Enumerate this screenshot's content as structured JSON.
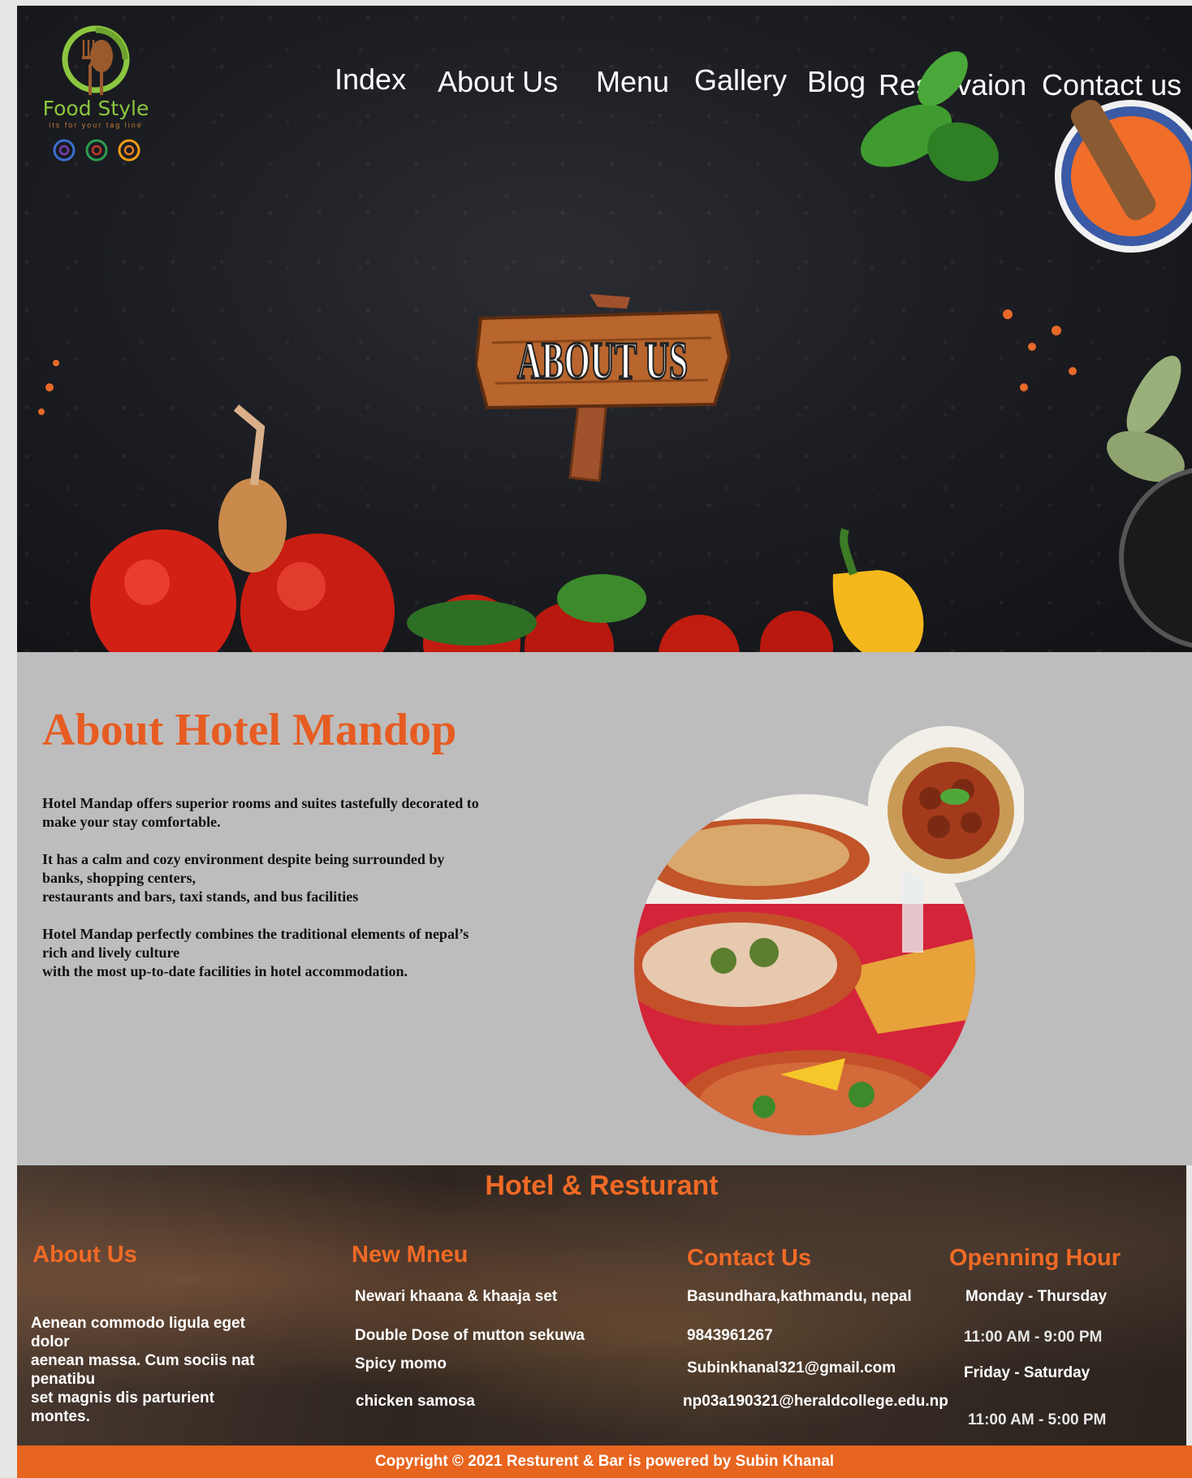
{
  "brand": {
    "name": "Food Style",
    "tagline": "its for your tag line"
  },
  "nav": {
    "items": [
      {
        "label": "Index"
      },
      {
        "label": "About Us"
      },
      {
        "label": "Menu"
      },
      {
        "label": "Gallery"
      },
      {
        "label": "Blog"
      },
      {
        "label": "Reservaion"
      },
      {
        "label": "Contact us"
      }
    ]
  },
  "hero": {
    "sign_text": "ABOUT US"
  },
  "about": {
    "title": "About Hotel Mandop",
    "paragraphs": [
      "Hotel Mandap offers superior rooms and suites tastefully decorated to\nmake your stay comfortable.",
      "It has a calm and cozy environment despite being surrounded by\nbanks, shopping centers,\nrestaurants and bars, taxi stands, and bus facilities",
      "Hotel Mandap perfectly combines the traditional elements of nepal’s\nrich and lively culture\nwith the most up-to-date facilities in hotel accommodation."
    ]
  },
  "footer": {
    "heading": "Hotel & Resturant",
    "about": {
      "title": "About Us",
      "text": "Aenean commodo ligula eget\ndolor\naenean massa. Cum sociis nat\npenatibu\nset magnis dis parturient\nmontes."
    },
    "menu": {
      "title": "New Mneu",
      "items": [
        "Newari khaana & khaaja set",
        "Double Dose of mutton sekuwa",
        "Spicy momo",
        "chicken samosa"
      ]
    },
    "contact": {
      "title": "Contact Us",
      "address": "Basundhara,kathmandu, nepal",
      "phone": "9843961267",
      "email1": "Subinkhanal321@gmail.com",
      "email2": "np03a190321@heraldcollege.edu.np"
    },
    "hours": {
      "title": "Openning Hour",
      "days1": "Monday - Thursday",
      "time1": "11:00 AM - 9:00 PM",
      "days2": "Friday - Saturday",
      "time2": "11:00 AM - 5:00 PM"
    },
    "copyright": "Copyright © 2021 Resturent & Bar is powered by Subin Khanal"
  },
  "colors": {
    "accent": "#e65c22",
    "logo_green": "#8cc63f",
    "hero_bg": "#1c1e23",
    "about_bg": "#bdbdbd"
  }
}
